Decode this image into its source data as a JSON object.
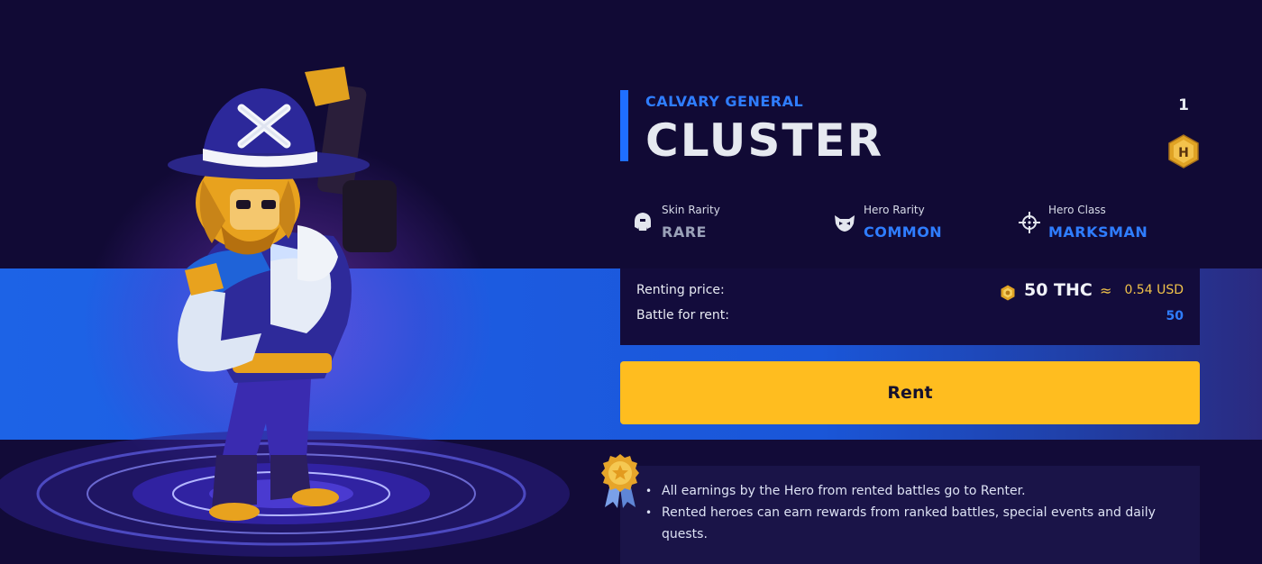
{
  "hero": {
    "subtitle": "CALVARY GENERAL",
    "name": "CLUSTER",
    "count": "1",
    "badge_letter": "H",
    "badge_icon": "hexagon-h-badge-icon"
  },
  "stats": [
    {
      "label": "Skin Rarity",
      "value": "RARE",
      "icon": "helmet-icon",
      "value_color": "#9aa1b8"
    },
    {
      "label": "Hero Rarity",
      "value": "COMMON",
      "icon": "mask-icon",
      "value_color": "#2f7dff"
    },
    {
      "label": "Hero Class",
      "value": "MARKSMAN",
      "icon": "crosshair-icon",
      "value_color": "#2f7dff"
    }
  ],
  "pricing": {
    "renting_label": "Renting price:",
    "battle_label": "Battle for rent:",
    "price": "50 THC",
    "approx": "≈",
    "usd": "0.54 USD",
    "battles": "50",
    "coin_icon": "thc-coin-icon"
  },
  "actions": {
    "rent_label": "Rent"
  },
  "info": {
    "items": [
      "All earnings by the Hero from rented battles go to Renter.",
      "Rented heroes can earn rewards from ranked battles, special events and daily quests."
    ],
    "icon": "medal-icon"
  },
  "colors": {
    "background": "#110a35",
    "band": "#1d63e6",
    "accent_blue": "#2f7dff",
    "button": "#ffbd1f",
    "gold_text": "#f0c24a"
  }
}
